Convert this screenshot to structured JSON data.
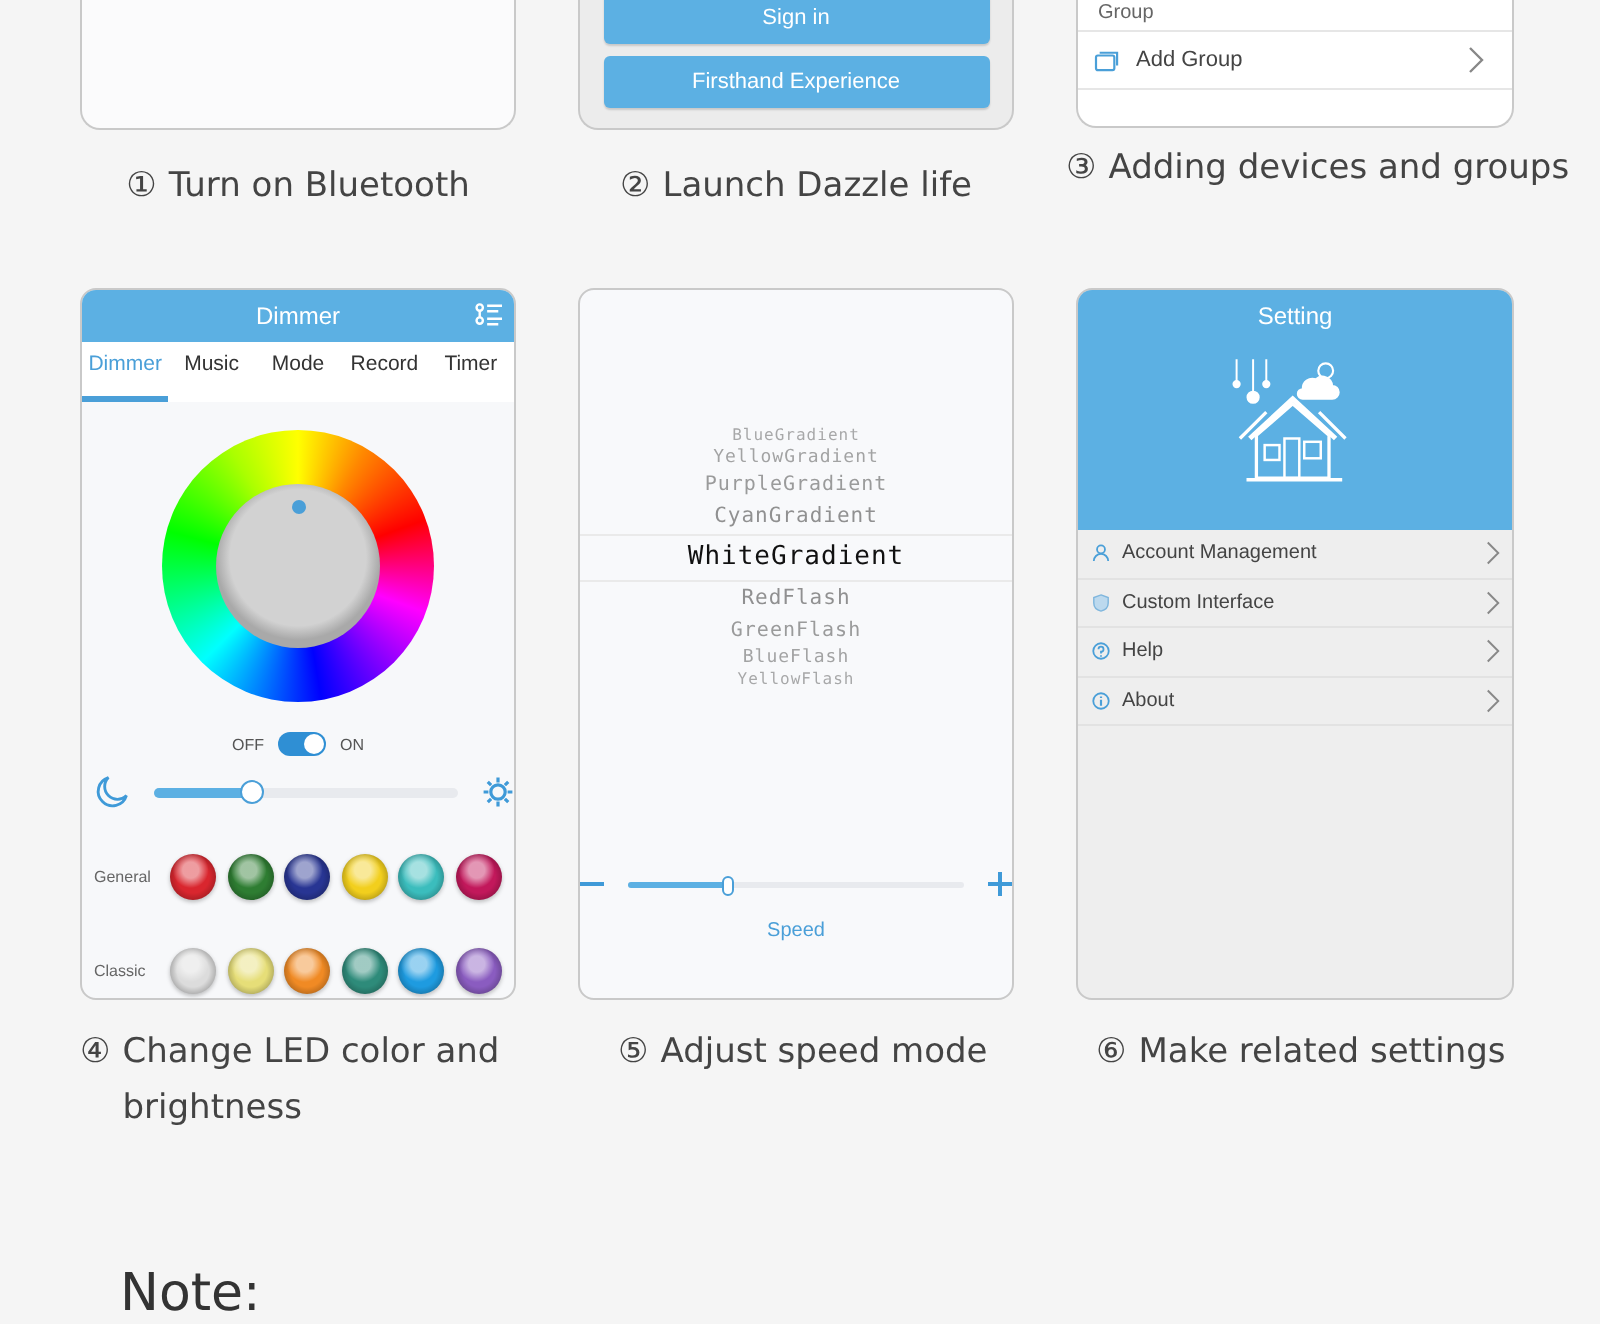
{
  "step1": {
    "number": "①",
    "caption": "Turn on Bluetooth"
  },
  "step2": {
    "number": "②",
    "caption": "Launch Dazzle life",
    "buttons": [
      "Sign in",
      "Firsthand Experience"
    ]
  },
  "step3": {
    "number": "③",
    "caption": "Adding devices and groups",
    "section_label": "Group",
    "rows": [
      {
        "label": "Add Group"
      }
    ]
  },
  "step4": {
    "number": "④",
    "caption": "Change LED color and brightness",
    "title": "Dimmer",
    "tabs": [
      {
        "label": "Dimmer",
        "selected": true
      },
      {
        "label": "Music",
        "selected": false
      },
      {
        "label": "Mode",
        "selected": false
      },
      {
        "label": "Record",
        "selected": false
      },
      {
        "label": "Timer",
        "selected": false
      }
    ],
    "power": {
      "off_label": "OFF",
      "on_label": "ON",
      "on": true
    },
    "brightness": {
      "level": 0.32
    },
    "palettes": [
      {
        "label": "General",
        "swatches": [
          {
            "color": "#d9262e"
          },
          {
            "color": "#2e7d32"
          },
          {
            "color": "#283593"
          },
          {
            "color": "#f2cf1d"
          },
          {
            "color": "#3bbdbd"
          },
          {
            "color": "#c2185b"
          }
        ]
      },
      {
        "label": "Classic",
        "swatches": [
          {
            "color": "#dcdcdc"
          },
          {
            "color": "#e6de78"
          },
          {
            "color": "#f08a24"
          },
          {
            "color": "#2e8b7a"
          },
          {
            "color": "#1e9be0"
          },
          {
            "color": "#8a5cc0"
          }
        ]
      }
    ]
  },
  "step5": {
    "number": "⑤",
    "caption": "Adjust speed mode",
    "modes": [
      {
        "label": "BlueGradient",
        "selected": false
      },
      {
        "label": "YellowGradient",
        "selected": false
      },
      {
        "label": "PurpleGradient",
        "selected": false
      },
      {
        "label": "CyanGradient",
        "selected": false
      },
      {
        "label": "WhiteGradient",
        "selected": true
      },
      {
        "label": "RedFlash",
        "selected": false
      },
      {
        "label": "GreenFlash",
        "selected": false
      },
      {
        "label": "BlueFlash",
        "selected": false
      },
      {
        "label": "YellowFlash",
        "selected": false
      }
    ],
    "speed": {
      "label": "Speed",
      "level": 0.3
    }
  },
  "step6": {
    "number": "⑥",
    "caption": "Make related settings",
    "title": "Setting",
    "items": [
      {
        "label": "Account Management",
        "kind": "person"
      },
      {
        "label": "Custom Interface",
        "kind": "shield"
      },
      {
        "label": "Help",
        "kind": "help"
      },
      {
        "label": "About",
        "kind": "info"
      }
    ]
  },
  "note": {
    "title": "Note:"
  }
}
